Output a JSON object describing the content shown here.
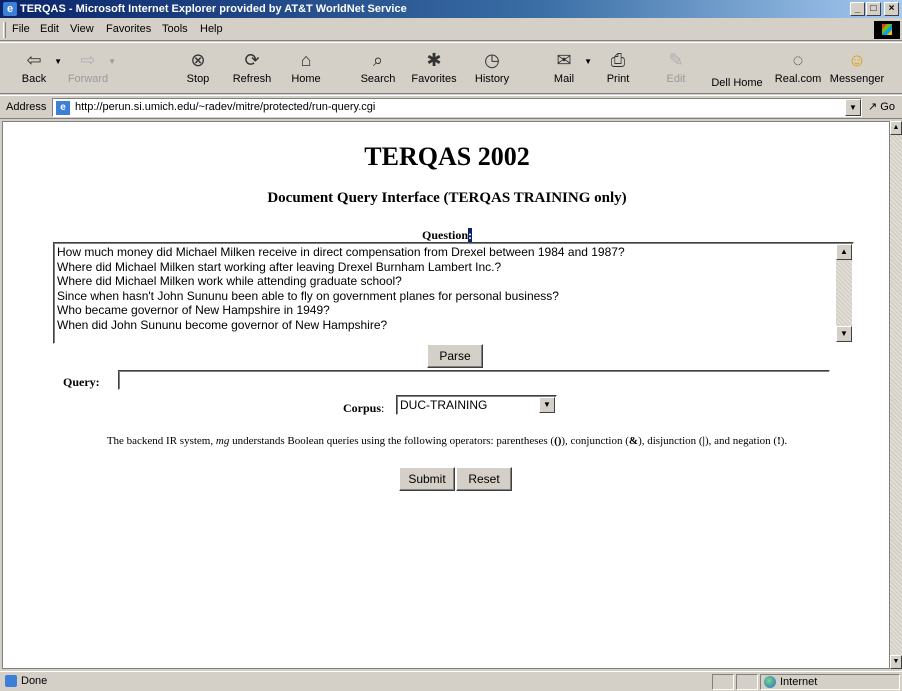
{
  "window": {
    "title": "TERQAS - Microsoft Internet Explorer provided by AT&T WorldNet Service",
    "controls": {
      "minimize": "_",
      "maximize": "□",
      "close": "×"
    }
  },
  "menu": {
    "file": "File",
    "edit": "Edit",
    "view": "View",
    "favorites": "Favorites",
    "tools": "Tools",
    "help": "Help"
  },
  "toolbar": {
    "back": "Back",
    "forward": "Forward",
    "stop": "Stop",
    "refresh": "Refresh",
    "home": "Home",
    "search": "Search",
    "favorites": "Favorites",
    "history": "History",
    "mail": "Mail",
    "print": "Print",
    "edit": "Edit",
    "dell_home": "Dell Home",
    "real_com": "Real.com",
    "messenger": "Messenger"
  },
  "address": {
    "label": "Address",
    "url": "http://perun.si.umich.edu/~radev/mitre/protected/run-query.cgi",
    "go": "Go"
  },
  "page": {
    "title": "TERQAS 2002",
    "subtitle": "Document Query Interface (TERQAS TRAINING only)",
    "question_label": "Question",
    "question_colon": ":",
    "questions": [
      "How much money did Michael Milken receive in direct compensation from Drexel between 1984 and 1987?",
      "Where did Michael Milken start working after leaving Drexel Burnham Lambert Inc.?",
      "Where did Michael Milken work while attending graduate school?",
      "Since when hasn't John Sununu been able to fly on government planes for personal business?",
      "Who became governor of New Hampshire in 1949?",
      "When did John Sununu become governor of New Hampshire?"
    ],
    "parse_button": "Parse",
    "query_label": "Query",
    "query_value": "",
    "corpus_label": "Corpus",
    "corpus_value": "DUC-TRAINING",
    "info_prefix": "The backend IR system, ",
    "info_system": "mg",
    "info_mid": " understands Boolean queries using the following operators: parentheses (",
    "info_paren": "()",
    "info_conj_text": "), conjunction (",
    "info_conj": "&",
    "info_disj_text": "), disjunction (",
    "info_disj": "|",
    "info_neg_text": "), and negation (",
    "info_neg": "!",
    "info_end": ").",
    "submit_button": "Submit",
    "reset_button": "Reset"
  },
  "status": {
    "text": "Done",
    "zone": "Internet"
  }
}
